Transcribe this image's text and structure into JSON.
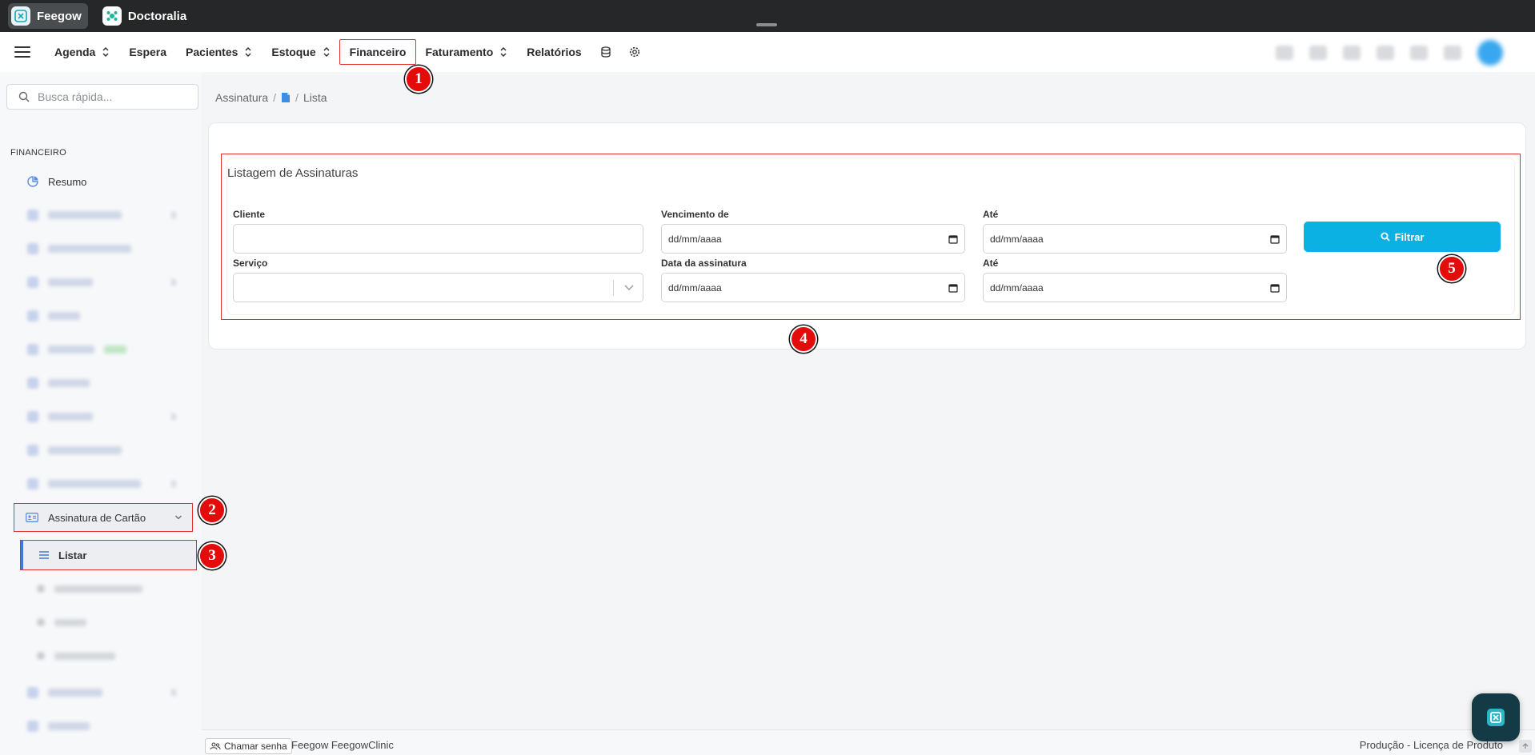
{
  "topbar": {
    "apps": [
      {
        "label": "Feegow",
        "active": true
      },
      {
        "label": "Doctoralia",
        "active": false
      }
    ]
  },
  "nav": {
    "items": [
      {
        "label": "Agenda",
        "dropdown": true
      },
      {
        "label": "Espera",
        "dropdown": false
      },
      {
        "label": "Pacientes",
        "dropdown": true
      },
      {
        "label": "Estoque",
        "dropdown": true
      },
      {
        "label": "Financeiro",
        "dropdown": false,
        "highlighted": true
      },
      {
        "label": "Faturamento",
        "dropdown": true
      },
      {
        "label": "Relatórios",
        "dropdown": false
      }
    ]
  },
  "sidebar": {
    "search_placeholder": "Busca rápida...",
    "section": "FINANCEIRO",
    "resumo": "Resumo",
    "parent_item": "Assinatura de Cartão",
    "active_child": "Listar"
  },
  "breadcrumb": {
    "first": "Assinatura",
    "last": "Lista"
  },
  "form": {
    "title": "Listagem de Assinaturas",
    "cliente_label": "Cliente",
    "cliente_value": "",
    "servico_label": "Serviço",
    "vencimento_label": "Vencimento de",
    "ate_label": "Até",
    "data_assinatura_label": "Data da assinatura",
    "date_placeholder": "dd/mm/aaaa",
    "filter_button": "Filtrar"
  },
  "badges": [
    "1",
    "2",
    "3",
    "4",
    "5"
  ],
  "footer": {
    "call_button": "Chamar senha",
    "brand": "Feegow FeegowClinic",
    "right_text": "Produção - Licença de Produto"
  },
  "colors": {
    "accent": "#0bb1e3",
    "highlight": "#e03131",
    "badge": "#e40b0b",
    "topbar": "#252728"
  }
}
